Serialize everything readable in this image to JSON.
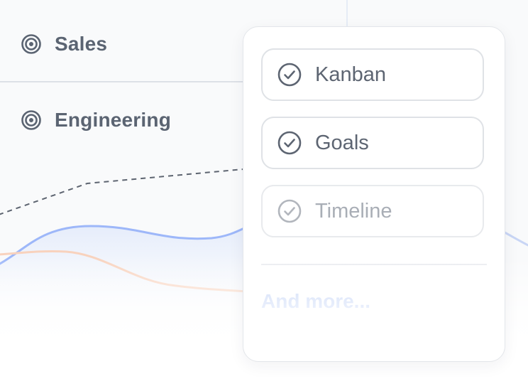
{
  "background": {
    "rows": [
      {
        "label": "Sales",
        "icon": "target-icon"
      },
      {
        "label": "Engineering",
        "icon": "target-icon"
      }
    ]
  },
  "popup": {
    "options": [
      {
        "label": "Kanban",
        "icon": "check-circle-icon",
        "state": "enabled"
      },
      {
        "label": "Goals",
        "icon": "check-circle-icon",
        "state": "enabled"
      },
      {
        "label": "Timeline",
        "icon": "check-circle-icon",
        "state": "muted"
      }
    ],
    "more_label": "And more..."
  },
  "colors": {
    "text": "#5b6472",
    "muted_text": "#a9aeb6",
    "more_text": "#c7d6f7",
    "blue_line": "#9db7f9",
    "orange_line": "#f8d2bd",
    "dashed_line": "#5d6470"
  }
}
